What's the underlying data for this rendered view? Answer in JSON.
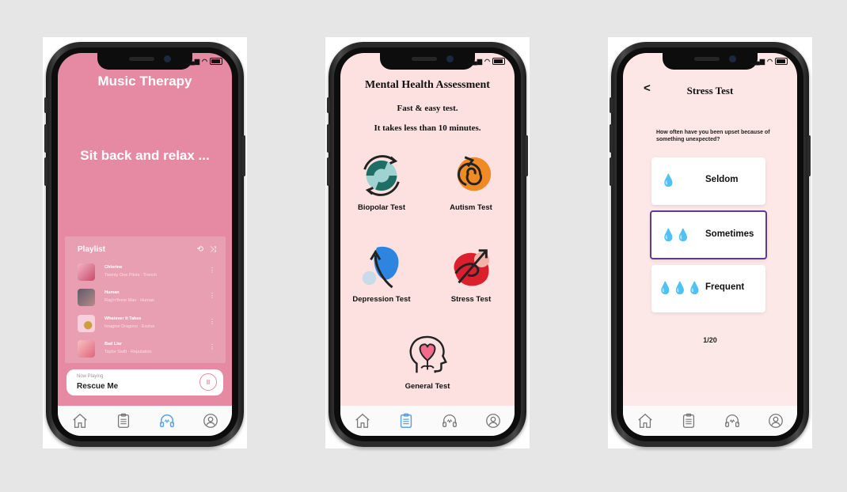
{
  "colors": {
    "page_bg": "#e6e6e7",
    "music_bg": "#e58aa2",
    "assess_bg": "#fce1e0",
    "accent_blue": "#5aa1e6",
    "selected_border": "#5c3d8f",
    "drop": "#5fb4ea"
  },
  "music_screen": {
    "title": "Music Therapy",
    "tagline": "Sit back and relax ...",
    "playlist": {
      "heading": "Playlist",
      "tracks": [
        {
          "name": "Chlorine",
          "artist": "Twenty One Pilots · Trench"
        },
        {
          "name": "Human",
          "artist": "Rag'n'Bone Man · Human"
        },
        {
          "name": "Whatever It Takes",
          "artist": "Imagine Dragons · Evolve"
        },
        {
          "name": "Bad Liar",
          "artist": "Taylor Swift · Reputation"
        }
      ]
    },
    "now_playing": {
      "label": "Now Playing",
      "song": "Rescue Me"
    }
  },
  "assessment_screen": {
    "title": "Mental Health Assessment",
    "subtitle1": "Fast & easy test.",
    "subtitle2": "It takes less than 10 minutes.",
    "tests": [
      {
        "label": "Biopolar Test",
        "icon": "biopolar-icon"
      },
      {
        "label": "Autism Test",
        "icon": "autism-icon"
      },
      {
        "label": "Depression Test",
        "icon": "depression-icon"
      },
      {
        "label": "Stress Test",
        "icon": "stress-icon"
      },
      {
        "label": "General Test",
        "icon": "general-icon"
      }
    ]
  },
  "stress_screen": {
    "back": "<",
    "title": "Stress Test",
    "question": "How often have you been upset because of something unexpected?",
    "options": [
      {
        "label": "Seldom",
        "drops": "💧",
        "selected": false
      },
      {
        "label": "Sometimes",
        "drops": "💧💧",
        "selected": true
      },
      {
        "label": "Frequent",
        "drops": "💧💧💧",
        "selected": false
      }
    ],
    "progress": "1/20"
  },
  "tabs": [
    "home-icon",
    "clipboard-icon",
    "headphones-icon",
    "profile-icon"
  ]
}
